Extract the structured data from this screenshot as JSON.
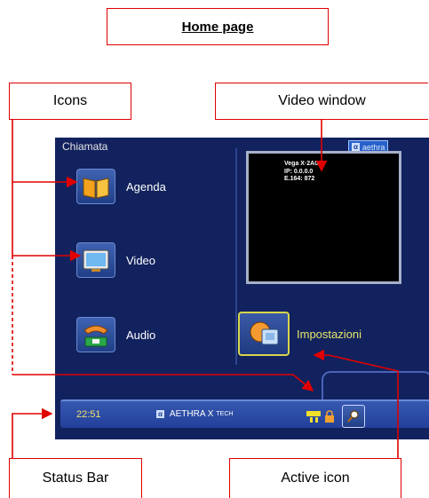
{
  "callouts": {
    "title": "Home page",
    "icons": "Icons",
    "video_window": "Video window",
    "status_bar": "Status Bar",
    "active_icon": "Active icon"
  },
  "screen": {
    "header_title": "Chiamata",
    "logo_text": "aethra",
    "logo_mark": "α",
    "menu": [
      {
        "label": "Agenda",
        "icon": "agenda-book-icon"
      },
      {
        "label": "Video",
        "icon": "video-monitor-icon"
      },
      {
        "label": "Audio",
        "icon": "audio-phone-icon"
      }
    ],
    "active_item": {
      "label": "Impostazioni",
      "icon": "settings-icon"
    },
    "video_info": [
      "Vega X·2A0",
      "IP: 0.0.0.0",
      "E.164: 872"
    ],
    "status": {
      "time": "22:51",
      "brand": "AETHRA X",
      "brand_suffix": "TECH",
      "brand_mark": "α"
    }
  },
  "colors": {
    "callout_border": "#e00000",
    "screen_bg": "#12225e",
    "status_bar": "#2a4aa8",
    "clock": "#f0e26a",
    "active_label": "#e6e66c"
  }
}
